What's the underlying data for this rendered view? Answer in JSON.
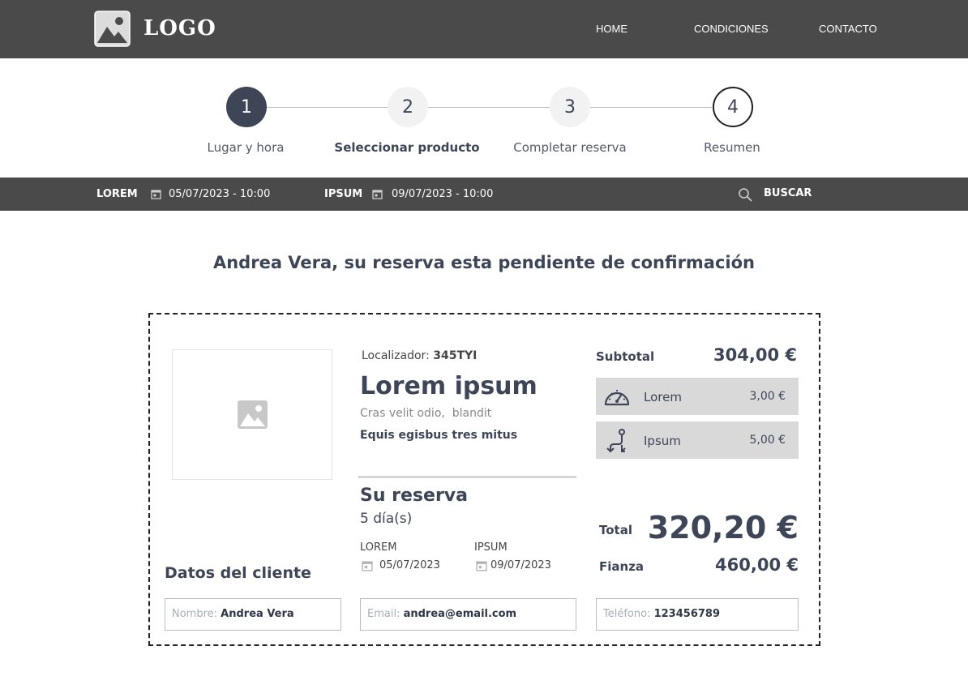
{
  "header": {
    "logo_text": "LOGO",
    "nav": [
      "HOME",
      "CONDICIONES",
      "CONTACTO"
    ]
  },
  "steps": [
    {
      "number": "1",
      "label": "Lugar y hora",
      "state": "completed"
    },
    {
      "number": "2",
      "label": "Seleccionar producto",
      "state": "current"
    },
    {
      "number": "3",
      "label": "Completar reserva",
      "state": "pending"
    },
    {
      "number": "4",
      "label": "Resumen",
      "state": "active"
    }
  ],
  "search": {
    "from_label": "LOREM",
    "from_date": "05/07/2023 - 10:00",
    "to_label": "IPSUM",
    "to_date": "09/07/2023 - 10:00",
    "button_label": "BUSCAR"
  },
  "headline": "Andrea Vera, su reserva esta pendiente de confirmación",
  "product": {
    "locator_label": "Localizador:",
    "locator_value": "345TYI",
    "title": "Lorem ipsum",
    "subtitle": "Cras velit odio,  blandit",
    "feature": "Equis egisbus tres mitus"
  },
  "reservation": {
    "title": "Su reserva",
    "days": "5 día(s)",
    "start_label": "LOREM",
    "start_date": "05/07/2023",
    "end_label": "IPSUM",
    "end_date": "09/07/2023"
  },
  "pricing": {
    "subtotal_label": "Subtotal",
    "subtotal_value": "304,00 €",
    "extras": [
      {
        "name": "Lorem",
        "price": "3,00 €",
        "icon": "speedometer-icon"
      },
      {
        "name": "Ipsum",
        "price": "5,00 €",
        "icon": "route-icon"
      }
    ],
    "total_label": "Total",
    "total_value": "320,20 €",
    "deposit_label": "Fianza",
    "deposit_value": "460,00 €"
  },
  "client": {
    "title": "Datos del cliente",
    "name_label": "Nombre:",
    "name_value": "Andrea Vera",
    "email_label": "Email:",
    "email_value": "andrea@email.com",
    "phone_label": "Teléfono:",
    "phone_value": "123456789"
  },
  "colors": {
    "header_bg": "#4a4a4a",
    "primary": "#3d4556",
    "extras_bg": "#d9d9d9"
  }
}
